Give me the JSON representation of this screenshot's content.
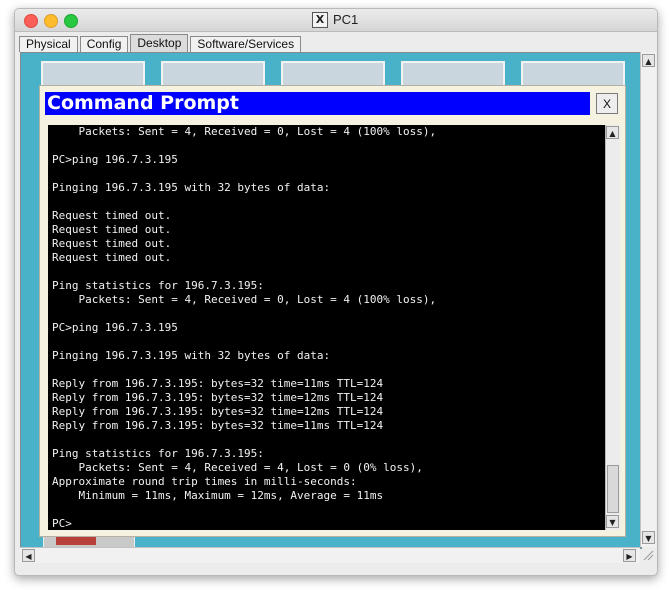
{
  "window": {
    "title": "PC1",
    "title_icon": "X"
  },
  "tabs": [
    {
      "label": "Physical"
    },
    {
      "label": "Config"
    },
    {
      "label": "Desktop",
      "active": true
    },
    {
      "label": "Software/Services"
    }
  ],
  "command_prompt": {
    "title": "Command Prompt",
    "close_label": "X",
    "terminal_lines": [
      "    Packets: Sent = 4, Received = 0, Lost = 4 (100% loss),",
      "",
      "PC>ping 196.7.3.195",
      "",
      "Pinging 196.7.3.195 with 32 bytes of data:",
      "",
      "Request timed out.",
      "Request timed out.",
      "Request timed out.",
      "Request timed out.",
      "",
      "Ping statistics for 196.7.3.195:",
      "    Packets: Sent = 4, Received = 0, Lost = 4 (100% loss),",
      "",
      "PC>ping 196.7.3.195",
      "",
      "Pinging 196.7.3.195 with 32 bytes of data:",
      "",
      "Reply from 196.7.3.195: bytes=32 time=11ms TTL=124",
      "Reply from 196.7.3.195: bytes=32 time=12ms TTL=124",
      "Reply from 196.7.3.195: bytes=32 time=12ms TTL=124",
      "Reply from 196.7.3.195: bytes=32 time=11ms TTL=124",
      "",
      "Ping statistics for 196.7.3.195:",
      "    Packets: Sent = 4, Received = 4, Lost = 0 (0% loss),",
      "Approximate round trip times in milli-seconds:",
      "    Minimum = 11ms, Maximum = 12ms, Average = 11ms",
      "",
      "PC>"
    ]
  },
  "colors": {
    "desktop_background": "#4ab2c8",
    "prompt_title_bar": "#0000ff",
    "terminal_background": "#000000",
    "terminal_text": "#f2f2f2"
  }
}
